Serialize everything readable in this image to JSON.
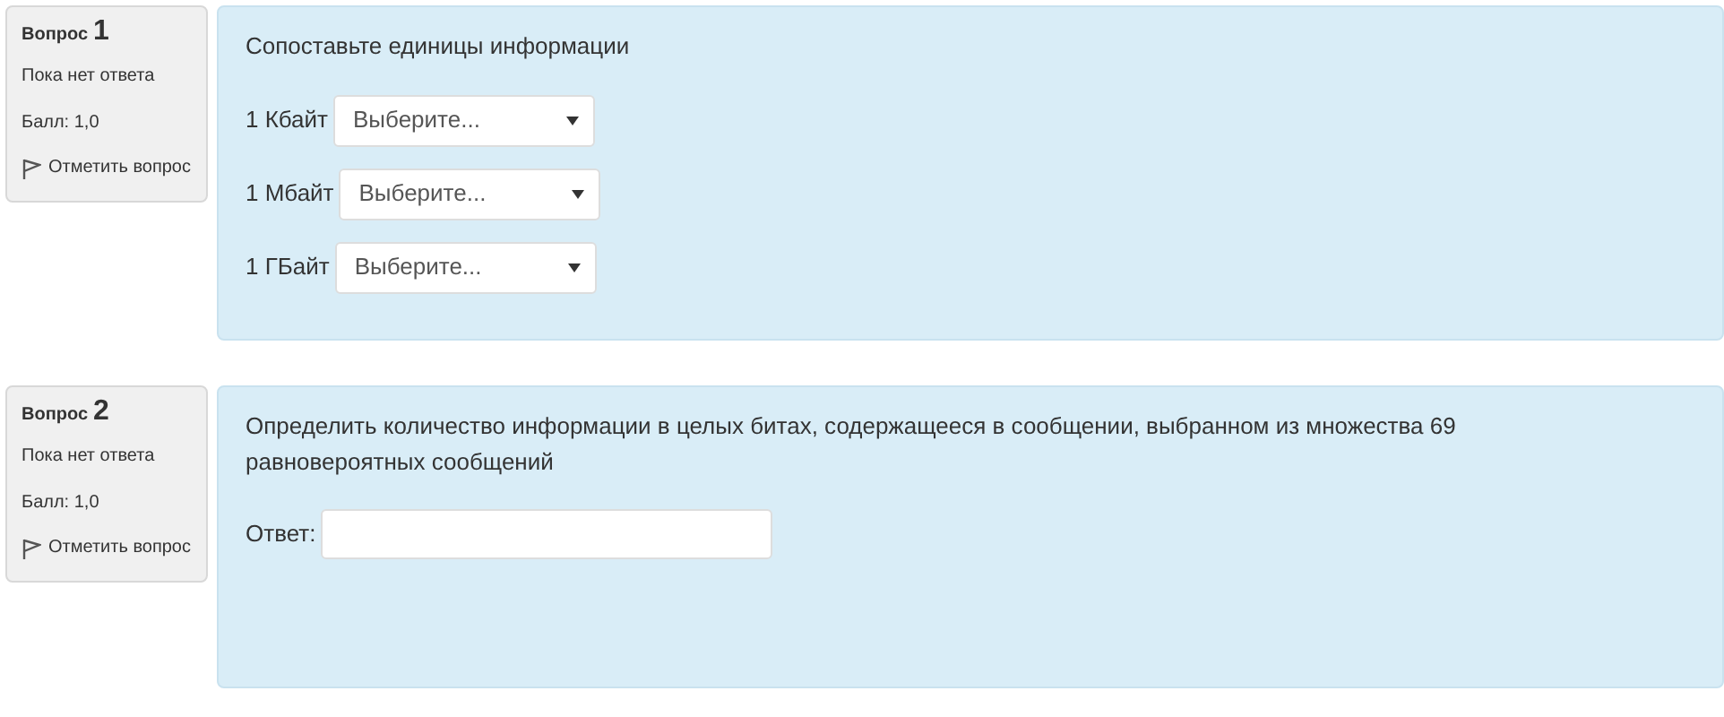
{
  "questions": [
    {
      "kind": "match",
      "label": "Вопрос",
      "number": "1",
      "status": "Пока нет ответа",
      "grade": "Балл: 1,0",
      "flag": "Отметить вопрос",
      "text": "Сопоставьте единицы информации",
      "rows": [
        {
          "label": "1 Кбайт",
          "value": "Выберите..."
        },
        {
          "label": "1 Мбайт",
          "value": "Выберите..."
        },
        {
          "label": "1 ГБайт",
          "value": "Выберите..."
        }
      ]
    },
    {
      "kind": "short",
      "label": "Вопрос",
      "number": "2",
      "status": "Пока нет ответа",
      "grade": "Балл: 1,0",
      "flag": "Отметить вопрос",
      "text": "Определить количество информации в целых битах, содержащееся в сообщении, выбранном из множества 69 равновероятных сообщений",
      "answer_label": "Ответ:"
    }
  ]
}
